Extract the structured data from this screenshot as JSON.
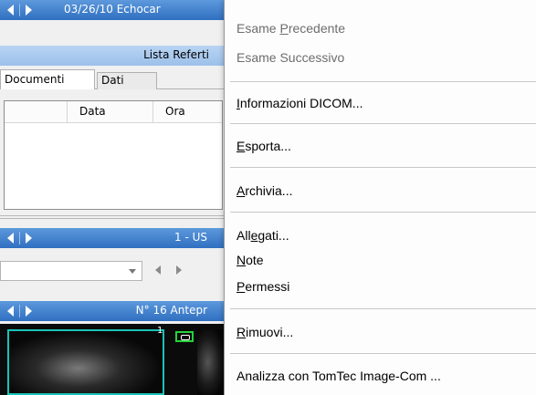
{
  "left_panel": {
    "header_top": {
      "label": "03/26/10 Echocar"
    },
    "subheader": {
      "label": "Lista Referti"
    },
    "tabs": [
      {
        "label": "Documenti",
        "active": true
      },
      {
        "label": "Dati",
        "active": false
      }
    ],
    "grid_columns": [
      "Data",
      "Ora"
    ],
    "header_mid": {
      "label": "1 - US"
    },
    "header_thumbs": {
      "label": "N° 16 Antepr"
    },
    "thumb_number": "1"
  },
  "menu": {
    "items": [
      {
        "prefix": "Esame ",
        "accel": "P",
        "suffix": "recedente",
        "enabled": false
      },
      {
        "prefix": "Esame Successivo",
        "accel": "",
        "suffix": "",
        "enabled": false
      },
      {
        "prefix": "",
        "accel": "I",
        "suffix": "nformazioni DICOM...",
        "enabled": true
      },
      {
        "prefix": "",
        "accel": "E",
        "suffix": "sporta...",
        "enabled": true
      },
      {
        "prefix": "",
        "accel": "A",
        "suffix": "rchivia...",
        "enabled": true
      },
      {
        "prefix": "All",
        "accel": "e",
        "suffix": "gati...",
        "enabled": true
      },
      {
        "prefix": "",
        "accel": "N",
        "suffix": "ote",
        "enabled": true
      },
      {
        "prefix": "",
        "accel": "P",
        "suffix": "ermessi",
        "enabled": true
      },
      {
        "prefix": "",
        "accel": "R",
        "suffix": "imuovi...",
        "enabled": true
      },
      {
        "prefix": "Analizza con TomTec Image-Com ...",
        "accel": "",
        "suffix": "",
        "enabled": true
      }
    ]
  },
  "colors": {
    "header_blue": "#2f6fc0",
    "subheader_blue": "#9cc0ea",
    "menu_bg": "#fdfdfd",
    "disabled_text": "#6d6d6d",
    "thumb_border": "#19c3b8",
    "badge_green": "#25d33a"
  }
}
